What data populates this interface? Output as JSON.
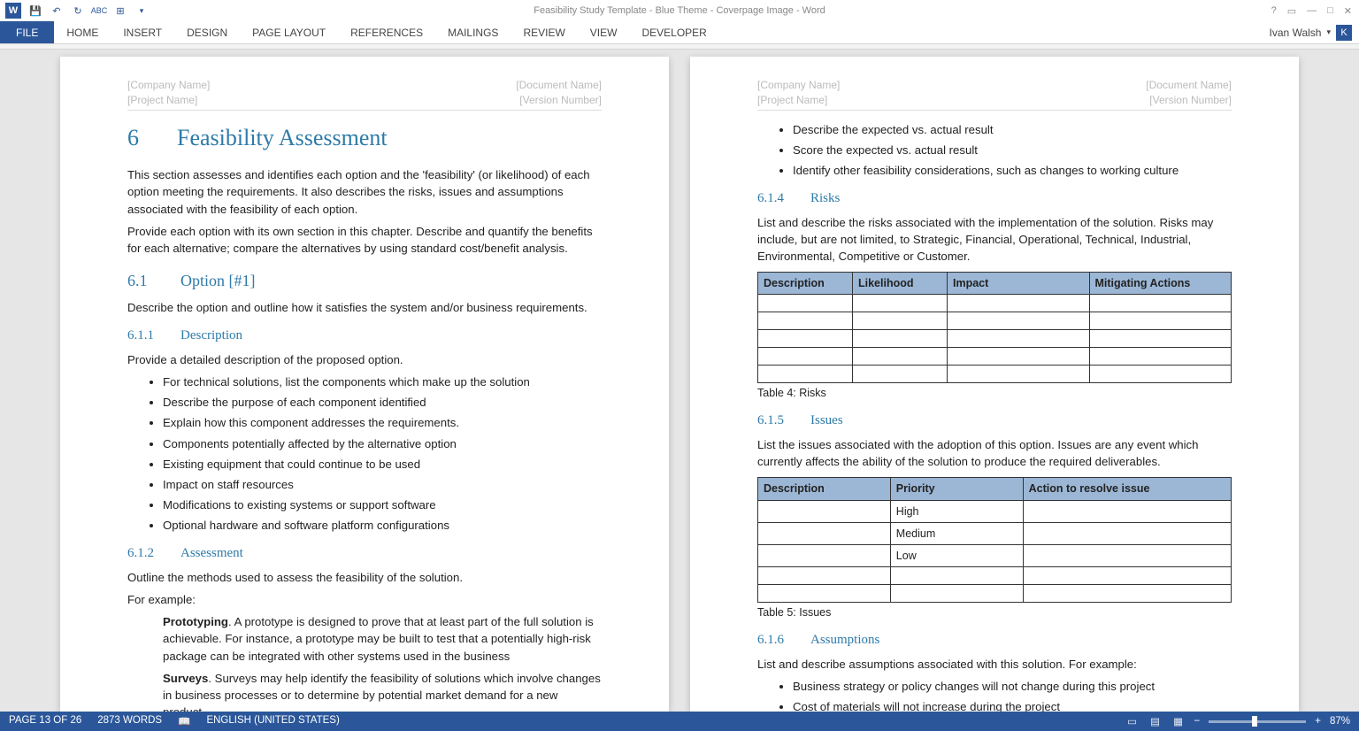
{
  "title": "Feasibility Study Template - Blue Theme - Coverpage Image - Word",
  "ribbon": {
    "file": "FILE",
    "tabs": [
      "HOME",
      "INSERT",
      "DESIGN",
      "PAGE LAYOUT",
      "REFERENCES",
      "MAILINGS",
      "REVIEW",
      "VIEW",
      "DEVELOPER"
    ]
  },
  "user": {
    "name": "Ivan Walsh",
    "initial": "K"
  },
  "header": {
    "leftTop": "[Company Name]",
    "leftBot": "[Project Name]",
    "rightTop": "[Document Name]",
    "rightBot": "[Version Number]"
  },
  "p1": {
    "h1_num": "6",
    "h1": "Feasibility Assessment",
    "intro1": "This section assesses and identifies each option and the 'feasibility' (or likelihood) of each option meeting the requirements. It also describes the risks, issues and assumptions associated with the feasibility of each option.",
    "intro2": "Provide each option with its own section in this chapter. Describe and quantify the benefits for each alternative; compare the alternatives by using standard cost/benefit analysis.",
    "h2_num": "6.1",
    "h2": "Option [#1]",
    "h2_text": "Describe the option and outline how it satisfies the system and/or business requirements.",
    "h3a_num": "6.1.1",
    "h3a": "Description",
    "h3a_text": "Provide a detailed description of the proposed option.",
    "bullets": [
      "For technical solutions, list the components which make up the solution",
      "Describe the purpose of each component identified",
      "Explain how this component addresses the requirements.",
      "Components potentially affected by the alternative option",
      "Existing equipment that could continue to be used",
      "Impact on staff resources",
      "Modifications to existing systems or support software",
      "Optional hardware and software platform configurations"
    ],
    "h3b_num": "6.1.2",
    "h3b": "Assessment",
    "h3b_text": "Outline the methods used to assess the feasibility of the solution.",
    "forex": "For example:",
    "proto_b": "Prototyping",
    "proto": ". A prototype is designed to prove that at least part of the full solution is achievable. For instance, a prototype may be built to test that a potentially high-risk package can be integrated with other systems used in the business",
    "surv_b": "Surveys",
    "surv": ". Surveys may help identify the feasibility of solutions which involve changes in business processes or to determine by potential market demand for a new product."
  },
  "p2": {
    "top_bullets": [
      "Describe the expected vs. actual result",
      "Score the expected vs. actual result",
      "Identify other feasibility considerations, such as changes to working culture"
    ],
    "h3c_num": "6.1.4",
    "h3c": "Risks",
    "h3c_text": "List and describe the risks associated with the implementation of the solution. Risks may include, but are not limited, to Strategic, Financial, Operational, Technical, Industrial, Environmental, Competitive or Customer.",
    "t4_headers": [
      "Description",
      "Likelihood",
      "Impact",
      "Mitigating Actions"
    ],
    "t4_cap": "Table 4: Risks",
    "h3d_num": "6.1.5",
    "h3d": "Issues",
    "h3d_text": "List the issues associated with the adoption of this option. Issues are any event which currently affects the ability of the solution to produce the required deliverables.",
    "t5_headers": [
      "Description",
      "Priority",
      "Action to resolve issue"
    ],
    "t5_rows": [
      "High",
      "Medium",
      "Low",
      "",
      ""
    ],
    "t5_cap": "Table 5: Issues",
    "h3e_num": "6.1.6",
    "h3e": "Assumptions",
    "h3e_text": "List and describe assumptions associated with this solution. For example:",
    "assump_bullets": [
      "Business strategy or policy changes will not change during this project",
      "Cost of materials will not increase during the project"
    ]
  },
  "status": {
    "page": "PAGE 13 OF 26",
    "words": "2873 WORDS",
    "lang": "ENGLISH (UNITED STATES)",
    "zoom": "87%"
  }
}
